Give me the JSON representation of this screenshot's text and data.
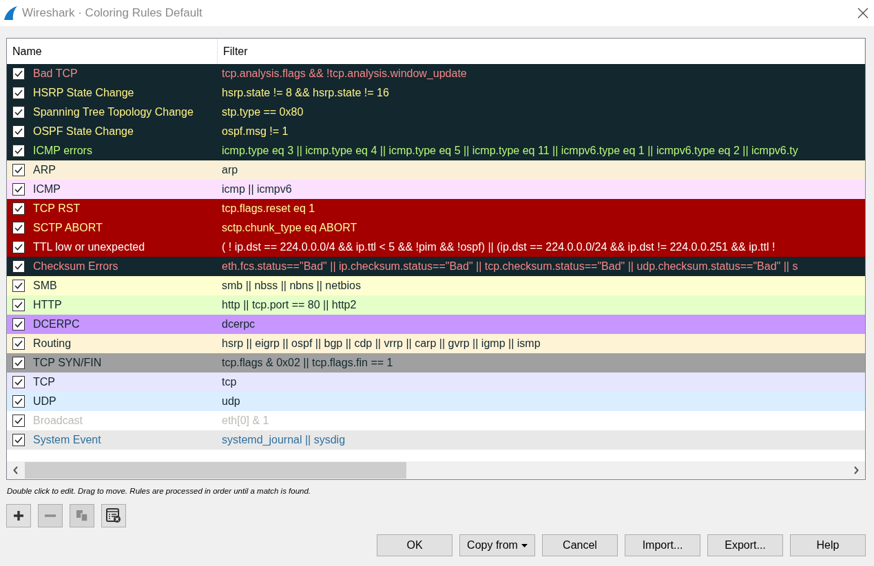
{
  "window": {
    "title": "Wireshark · Coloring Rules Default"
  },
  "table": {
    "columns": [
      "Name",
      "Filter"
    ],
    "rows": [
      {
        "checked": true,
        "name": "Bad TCP",
        "filter": "tcp.analysis.flags && !tcp.analysis.window_update",
        "color": "#12272e",
        "text": {
          "color": "#f78787"
        }
      },
      {
        "checked": true,
        "name": "HSRP State Change",
        "filter": "hsrp.state != 8 && hsrp.state != 16",
        "color": "#12272e",
        "text": {
          "color": "#fff287"
        }
      },
      {
        "checked": true,
        "name": "Spanning Tree Topology  Change",
        "filter": "stp.type == 0x80",
        "color": "#12272e",
        "text": {
          "color": "#fff287"
        }
      },
      {
        "checked": true,
        "name": "OSPF State Change",
        "filter": "ospf.msg != 1",
        "color": "#12272e",
        "text": {
          "color": "#fff287"
        }
      },
      {
        "checked": true,
        "name": "ICMP errors",
        "filter": "icmp.type eq 3 || icmp.type eq 4 || icmp.type eq 5 || icmp.type eq 11 || icmpv6.type eq 1 || icmpv6.type eq 2 || icmpv6.ty",
        "color": "#12272e",
        "text": {
          "color": "#b7f774"
        }
      },
      {
        "checked": true,
        "name": "ARP",
        "filter": "arp",
        "color": "#faf0d7",
        "text": {
          "color": "#12272e"
        }
      },
      {
        "checked": true,
        "name": "ICMP",
        "filter": "icmp || icmpv6",
        "color": "#fce0ff",
        "text": {
          "color": "#12272e"
        }
      },
      {
        "checked": true,
        "name": "TCP RST",
        "filter": "tcp.flags.reset eq 1",
        "color": "#a40000",
        "text": {
          "color": "#fffc9c"
        }
      },
      {
        "checked": true,
        "name": "SCTP ABORT",
        "filter": "sctp.chunk_type eq ABORT",
        "color": "#a40000",
        "text": {
          "color": "#fffc9c"
        }
      },
      {
        "checked": true,
        "name": "TTL low or unexpected",
        "filter": "( ! ip.dst == 224.0.0.0/4 && ip.ttl < 5 && !pim && !ospf) || (ip.dst == 224.0.0.0/24 && ip.dst != 224.0.0.251 && ip.ttl !",
        "color": "#a40000",
        "text": {
          "color": "#fffffb"
        }
      },
      {
        "checked": true,
        "name": "Checksum Errors",
        "filter": "eth.fcs.status==\"Bad\" || ip.checksum.status==\"Bad\" || tcp.checksum.status==\"Bad\" || udp.checksum.status==\"Bad\" || s",
        "color": "#12272e",
        "text": {
          "color": "#f78787"
        }
      },
      {
        "checked": true,
        "name": "SMB",
        "filter": "smb || nbss || nbns || netbios",
        "color": "#feffd0",
        "text": {
          "color": "#12272e"
        }
      },
      {
        "checked": true,
        "name": "HTTP",
        "filter": "http || tcp.port == 80 || http2",
        "color": "#e4ffc7",
        "text": {
          "color": "#12272e"
        }
      },
      {
        "checked": true,
        "name": "DCERPC",
        "filter": "dcerpc",
        "color": "#c797ff",
        "text": {
          "color": "#12272e"
        }
      },
      {
        "checked": true,
        "name": "Routing",
        "filter": "hsrp || eigrp || ospf || bgp || cdp || vrrp || carp || gvrp || igmp || ismp",
        "color": "#fff3d6",
        "text": {
          "color": "#12272e"
        }
      },
      {
        "checked": true,
        "name": "TCP SYN/FIN",
        "filter": "tcp.flags & 0x02 || tcp.flags.fin == 1",
        "color": "#a0a0a0",
        "text": {
          "color": "#12272e"
        }
      },
      {
        "checked": true,
        "name": "TCP",
        "filter": "tcp",
        "color": "#e7e6ff",
        "text": {
          "color": "#12272e"
        }
      },
      {
        "checked": true,
        "name": "UDP",
        "filter": "udp",
        "color": "#daeeff",
        "text": {
          "color": "#12272e"
        }
      },
      {
        "checked": true,
        "name": "Broadcast",
        "filter": "eth[0] & 1",
        "color": "#ffffff",
        "text": {
          "color": "#babdb6"
        }
      },
      {
        "checked": true,
        "name": "System Event",
        "filter": "systemd_journal || sysdig",
        "color": "#e8e8e8",
        "text": {
          "color": "#30709e"
        }
      }
    ]
  },
  "hint": "Double click to edit. Drag to move. Rules are processed in order until a match is found.",
  "tools": [
    {
      "kind": "add",
      "disabled": false
    },
    {
      "kind": "remove",
      "disabled": true
    },
    {
      "kind": "copy",
      "disabled": true
    },
    {
      "kind": "clear",
      "disabled": false
    }
  ],
  "buttons": [
    {
      "label": "OK",
      "kind": "plain"
    },
    {
      "label": "Copy from",
      "kind": "menu"
    },
    {
      "label": "Cancel",
      "kind": "plain"
    },
    {
      "label": "Import...",
      "kind": "plain"
    },
    {
      "label": "Export...",
      "kind": "plain"
    },
    {
      "label": "Help",
      "kind": "plain"
    }
  ]
}
